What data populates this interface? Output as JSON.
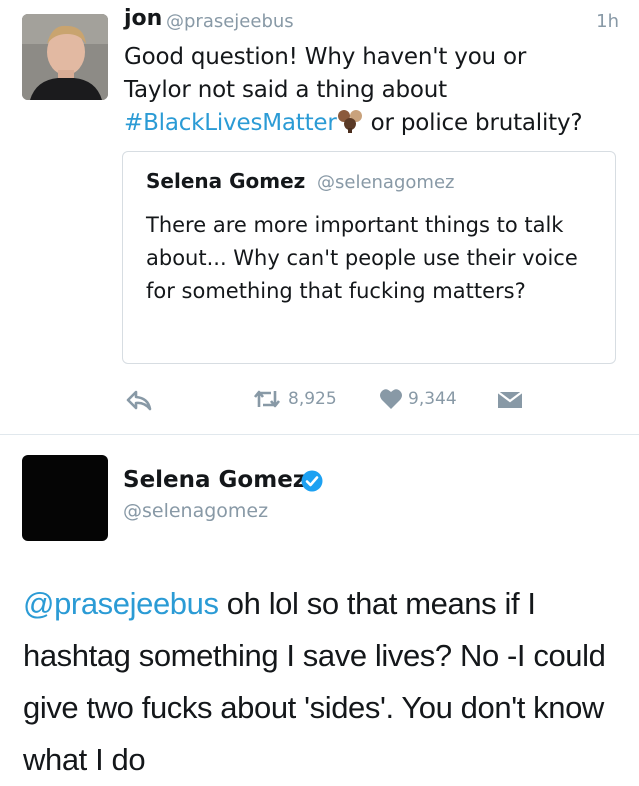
{
  "tweet": {
    "name": "jon",
    "handle": "@prasejeebus",
    "time": "1h",
    "text_line1": "Good question! Why haven't you or",
    "text_line2": "Taylor not said a thing about",
    "hashtag": "#BlackLivesMatter",
    "emoji": "raised-fists-emoji",
    "text_after_hashtag": "or police brutality?"
  },
  "quoted_tweet": {
    "name": "Selena Gomez",
    "handle": "@selenagomez",
    "text": "There are more important things to talk about... Why can't people use their voice for something that fucking matters?"
  },
  "actions": {
    "retweets": "8,925",
    "likes": "9,344"
  },
  "reply_tweet": {
    "name": "Selena Gomez",
    "handle": "@selenagomez",
    "verified": true,
    "mention": "@prasejeebus",
    "text": "oh lol so that means if I hashtag something I save lives? No -I could give two fucks about 'sides'. You don't know what I do"
  },
  "colors": {
    "link": "#2b9bd5",
    "muted": "#8899a6",
    "verified": "#1da1f2"
  }
}
